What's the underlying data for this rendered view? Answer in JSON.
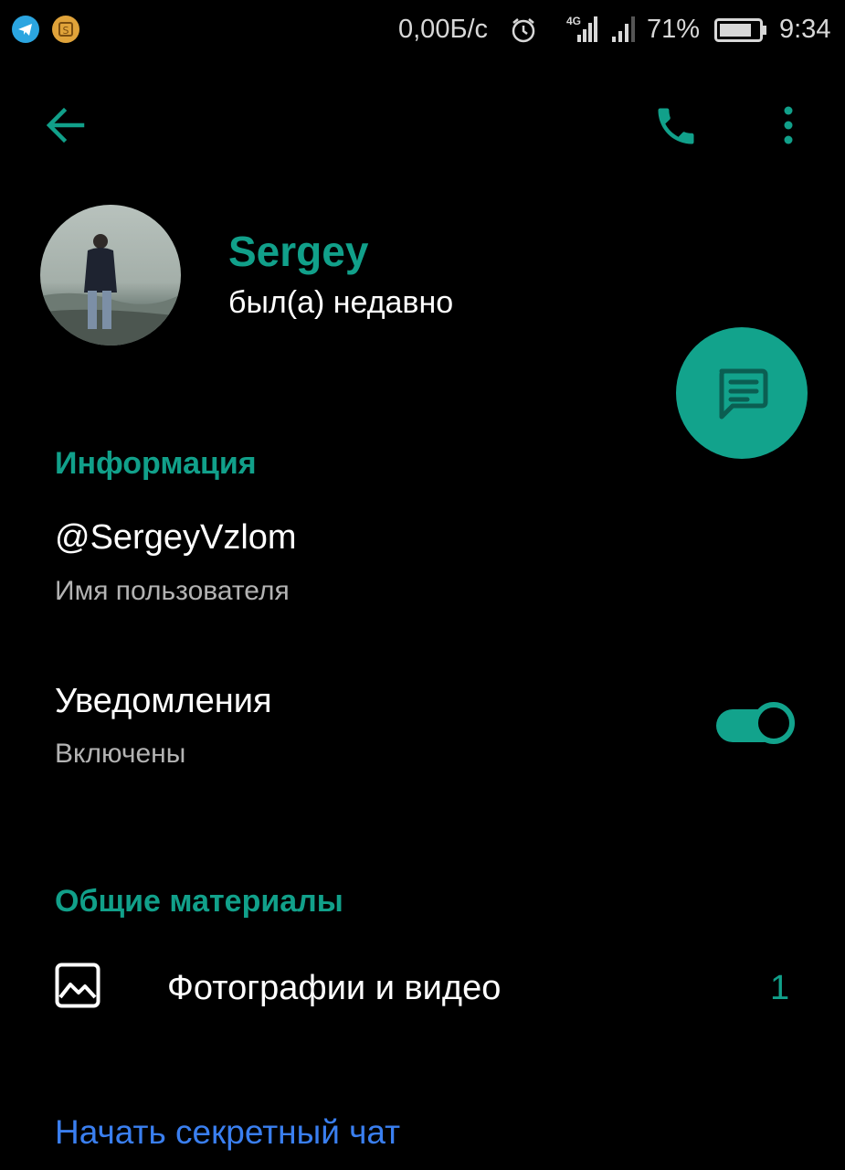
{
  "status_bar": {
    "left_icons": [
      "telegram-icon",
      "app-notification-icon"
    ],
    "net_speed": "0,00Б/с",
    "alarm_icon": "alarm-icon",
    "network_label": "4G",
    "battery_percent": "71%",
    "time": "9:34"
  },
  "toolbar": {
    "back_icon": "back-arrow-icon",
    "call_icon": "phone-icon",
    "menu_icon": "more-vert-icon"
  },
  "profile": {
    "name": "Sergey",
    "last_seen": "был(а) недавно",
    "message_button_icon": "message-icon"
  },
  "info_section": {
    "title": "Информация",
    "username_value": "@SergeyVzlom",
    "username_label": "Имя пользователя",
    "notifications_label": "Уведомления",
    "notifications_status": "Включены",
    "notifications_enabled": true
  },
  "shared_section": {
    "title": "Общие материалы",
    "photos_label": "Фотографии и видео",
    "photos_count": "1"
  },
  "secret_chat_link": "Начать секретный чат",
  "colors": {
    "accent": "#11a08a",
    "link": "#3a7ff0",
    "background": "#000000"
  }
}
